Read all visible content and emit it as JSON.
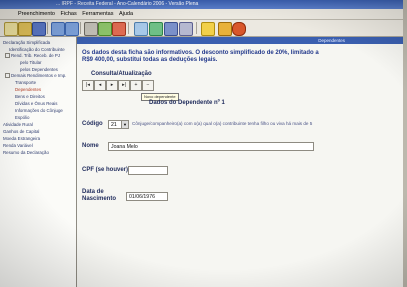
{
  "window": {
    "title": "... IRPF - Receita Federal - Ano-Calendário 2006 - Versão Plena"
  },
  "menu": [
    "Preenchimento",
    "Fichas",
    "Ferramentas",
    "Ajuda"
  ],
  "toolbar_icons": [
    "new-icon",
    "open-icon",
    "save-icon",
    "back-icon",
    "forward-icon",
    "print-icon",
    "check-icon",
    "calc-icon",
    "import-icon",
    "export-icon",
    "search-icon",
    "info-icon",
    "help-icon",
    "tax-icon"
  ],
  "sidebar": {
    "items": [
      {
        "label": "Declaração Simplificada",
        "level": 0
      },
      {
        "label": "Identificação do Contribuinte",
        "level": 1
      },
      {
        "label": "Rend. Trib. Receb. de PJ",
        "level": 1
      },
      {
        "label": "pelo Titular",
        "level": 2
      },
      {
        "label": "pelos Dependentes",
        "level": 2
      },
      {
        "label": "Demais Rendimentos e Imp.",
        "level": 1
      },
      {
        "label": "Transporte",
        "level": 2
      },
      {
        "label": "Dependentes",
        "level": 2,
        "selected": true
      },
      {
        "label": "Bens e Direitos",
        "level": 2
      },
      {
        "label": "Dívidas e Ônus Reais",
        "level": 2
      },
      {
        "label": "Informações do Cônjuge",
        "level": 2
      },
      {
        "label": "Espólio",
        "level": 2
      },
      {
        "label": "Atividade Rural",
        "level": 0
      },
      {
        "label": "Ganhos de Capital",
        "level": 0
      },
      {
        "label": "Moeda Estrangeira",
        "level": 0
      },
      {
        "label": "Renda Variável",
        "level": 0
      },
      {
        "label": "Resumo da Declaração",
        "level": 0
      }
    ]
  },
  "main": {
    "header": "Dependentes",
    "info_line1": "Os dados desta ficha são informativos. O desconto simplificado de 20%, limitado a",
    "info_line2": "R$9 400,00, substitui todas as deduções legais.",
    "section_title": "Consulta/Atualização",
    "nav_buttons": [
      "|◂",
      "◂",
      "▸",
      "▸|",
      "+",
      "−"
    ],
    "tooltip": "Novo dependente",
    "dependent_title": "Dados do Dependente nº 1",
    "codigo_label": "Código",
    "codigo_value": "21",
    "codigo_help": "Cônjuge/companheiro(a) com o(a) qual o(a) contribuinte tenha filho ou viva há mais de 5",
    "nome_label": "Nome",
    "nome_value": "Joana Melo",
    "cpf_label": "CPF (se houver)",
    "cpf_value": "",
    "nasc_label_1": "Data de",
    "nasc_label_2": "Nascimento",
    "nasc_value": "01/06/1976"
  }
}
